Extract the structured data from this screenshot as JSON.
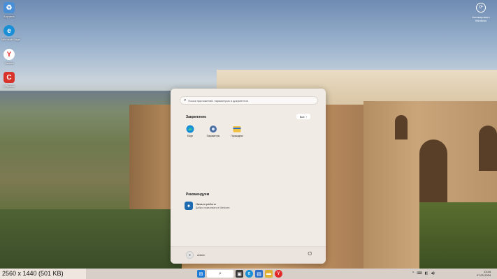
{
  "desktop": {
    "icons": [
      {
        "label": "Корзина",
        "icon": "recycle-bin-icon",
        "color": "#4a8fd6"
      },
      {
        "label": "Microsoft Edge",
        "icon": "edge-icon",
        "color": "#1a8fd6"
      },
      {
        "label": "Yandex",
        "icon": "yandex-icon",
        "color": "#e32a2a"
      },
      {
        "label": "CCleaner",
        "icon": "ccleaner-icon",
        "color": "#d9342b"
      }
    ],
    "activation": {
      "icon": "activate-icon",
      "line1": "Активировать",
      "line2": "Windows"
    }
  },
  "start_menu": {
    "search_placeholder": "Поиск приложений, параметров и документов",
    "pinned_title": "Закреплено",
    "all_button": "Все",
    "pinned": [
      {
        "label": "Edge",
        "icon": "edge-icon",
        "color": "#1a8fd6"
      },
      {
        "label": "Параметры",
        "icon": "settings-icon",
        "color": "#4a6fa5"
      },
      {
        "label": "Проводник",
        "icon": "folder-icon",
        "color": "#f0c040"
      }
    ],
    "recommended_title": "Рекомендуем",
    "recommended": [
      {
        "title": "Начало работы",
        "subtitle": "Добро пожаловать в Windows",
        "icon": "get-started-icon"
      }
    ],
    "user_name": "Admin"
  },
  "taskbar": {
    "apps": [
      {
        "icon": "start-icon",
        "color": "#1f7ad6"
      },
      {
        "icon": "search-icon",
        "color": "#6a6a6a"
      },
      {
        "icon": "task-view-icon",
        "color": "#3a3a3a"
      },
      {
        "icon": "edge-icon",
        "color": "#1a8fd6"
      },
      {
        "icon": "store-icon",
        "color": "#2f6fc7"
      },
      {
        "icon": "folder-icon",
        "color": "#e0b030"
      },
      {
        "icon": "yandex-icon",
        "color": "#e32a2a"
      }
    ],
    "time": "13:44",
    "date": "07.02.2024"
  },
  "status_bar": "2560 x 1440 (501 KB)"
}
